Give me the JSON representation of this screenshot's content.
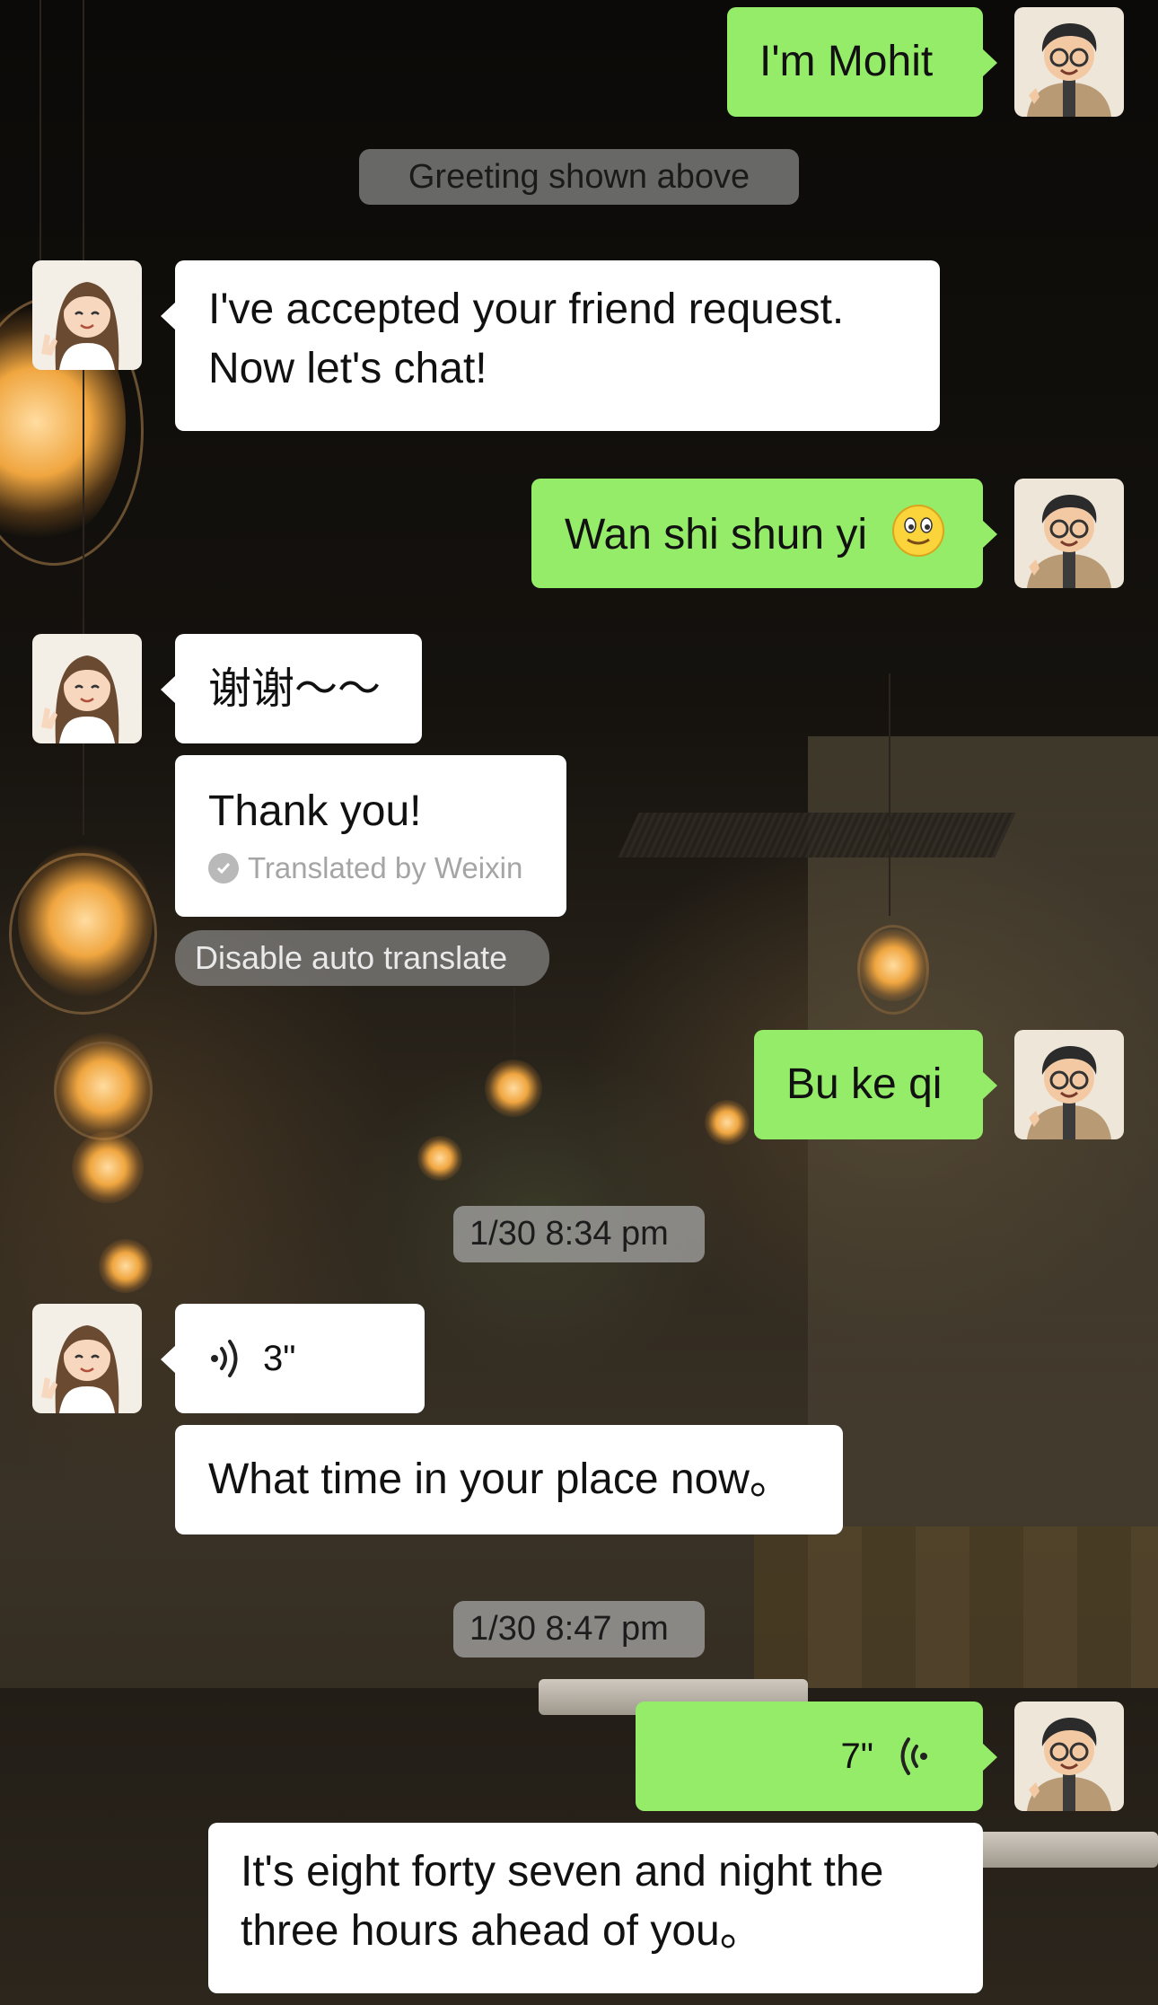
{
  "conversation": {
    "messages": [
      {
        "id": "m1",
        "sender": "me",
        "type": "text",
        "text": "I'm Mohit"
      },
      {
        "id": "sys1",
        "type": "system",
        "text": "Greeting shown above"
      },
      {
        "id": "m2",
        "sender": "them",
        "type": "text",
        "text": "I've accepted your friend request. Now let's chat!"
      },
      {
        "id": "m3",
        "sender": "me",
        "type": "text",
        "text": "Wan shi shun yi",
        "emoji": "smile-emoji"
      },
      {
        "id": "m4",
        "sender": "them",
        "type": "text",
        "text": "谢谢～～"
      },
      {
        "id": "m5",
        "sender": "them",
        "type": "translation",
        "text": "Thank you!",
        "translated_by": "Translated by Weixin"
      },
      {
        "id": "act1",
        "type": "action",
        "text": "Disable auto translate"
      },
      {
        "id": "m6",
        "sender": "me",
        "type": "text",
        "text": "Bu ke qi"
      },
      {
        "id": "t1",
        "type": "timestamp",
        "text": "1/30 8:34 pm"
      },
      {
        "id": "m7",
        "sender": "them",
        "type": "voice",
        "duration": "3\""
      },
      {
        "id": "m8",
        "sender": "them",
        "type": "text",
        "text": "What time in your place now。"
      },
      {
        "id": "t2",
        "type": "timestamp",
        "text": "1/30 8:47 pm"
      },
      {
        "id": "m9",
        "sender": "me",
        "type": "voice",
        "duration": "7\""
      },
      {
        "id": "m10",
        "sender": "me",
        "type": "transcript",
        "text": "It's eight forty seven and night the three hours ahead of you。"
      }
    ]
  },
  "colors": {
    "my_bubble": "#95ec69",
    "their_bubble": "#ffffff",
    "system_pill": "#8c8c8c"
  },
  "icons": {
    "my_avatar": "cartoon-man-with-glasses-avatar",
    "their_avatar": "cartoon-woman-peace-sign-avatar",
    "voice": "voice-wave-icon",
    "check": "check-circle-icon"
  }
}
